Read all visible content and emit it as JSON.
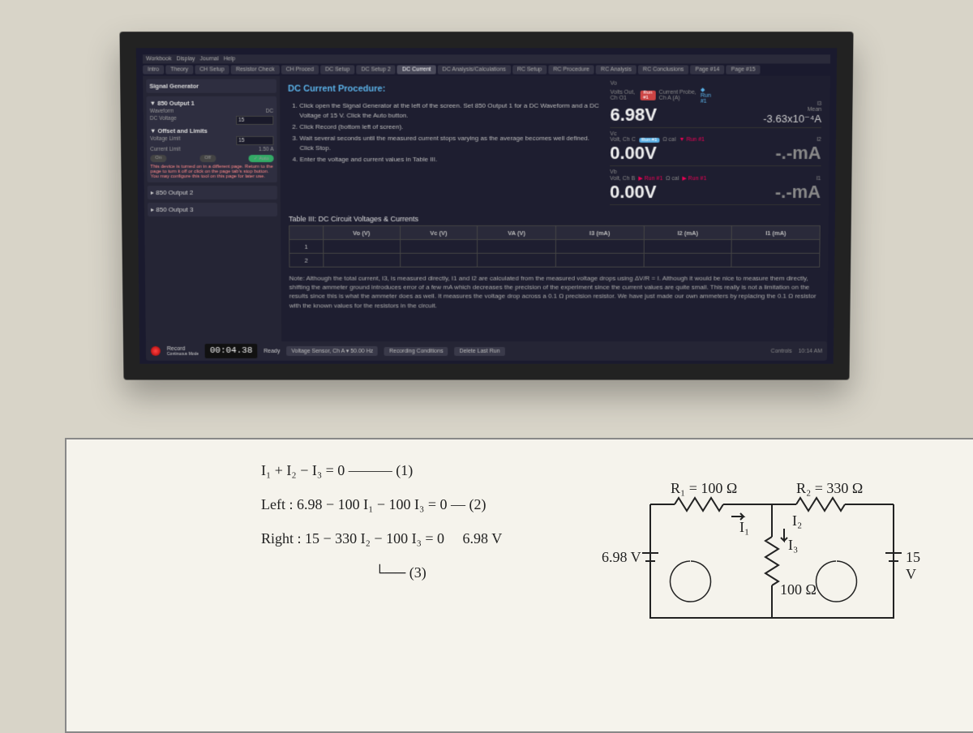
{
  "menubar": [
    "Workbook",
    "Display",
    "Journal",
    "Help"
  ],
  "tabs": [
    "Intro",
    "Theory",
    "CH Setup",
    "Resistor Check",
    "CH Proced",
    "DC Setup",
    "DC Setup 2",
    "DC Current",
    "DC Analysis/Calculations",
    "RC Setup",
    "RC Procedure",
    "RC Analysis",
    "RC Conclusions",
    "Page #14",
    "Page #15"
  ],
  "active_tab": 7,
  "sidebar": {
    "panel1_title": "Signal Generator",
    "output1_title": "850 Output 1",
    "waveform_label": "Waveform",
    "waveform_value": "DC",
    "dcvoltage_label": "DC Voltage",
    "dcvoltage_value": "15",
    "offset_title": "Offset and Limits",
    "vlimit_label": "Voltage Limit",
    "vlimit_value": "15",
    "climit_label": "Current Limit",
    "climit_value": "1.50 A",
    "on": "On",
    "off": "Off",
    "auto": "Auto",
    "warning": "This device is turned on in a different page. Return to the page to turn it off or click on the page tab's stop button. You may configure this tool on this page for later use.",
    "output2": "850 Output 2",
    "output3": "850 Output 3"
  },
  "procedure": {
    "title": "DC Current Procedure:",
    "steps": [
      "Click open the Signal Generator at the left of the screen. Set 850 Output 1 for a DC Waveform and a DC Voltage of 15 V. Click the Auto button.",
      "Click Record (bottom left of screen).",
      "Wait several seconds until the measured current stops varying as the average becomes well defined. Click Stop.",
      "Enter the voltage and current values in Table III."
    ]
  },
  "measurements": {
    "vo": {
      "label": "Vo",
      "sub": "Volts Out, Ch O1",
      "run": "Run #1",
      "probe": "Current Probe, Ch A (A)",
      "value": "6.98V",
      "i_label": "I3",
      "i_sub": "Mean",
      "i_value": "-3.63x10⁻⁴A",
      "extra": "Run #1"
    },
    "vc": {
      "label": "Vc",
      "sub": "Volt, Ch C",
      "run": "Run #1",
      "probe": "Ω cal",
      "value": "0.00V",
      "i_label": "I2",
      "i_value": "-.-mA",
      "extra": "Run #1"
    },
    "vb": {
      "label": "Vb",
      "sub": "Volt, Ch B",
      "run": "Run #1",
      "probe": "Ω cal",
      "value": "0.00V",
      "i_label": "I1",
      "i_value": "-.-mA",
      "extra": "Run #1"
    }
  },
  "table": {
    "title": "Table III: DC Circuit Voltages & Currents",
    "headers": [
      "",
      "Vo (V)",
      "Vc (V)",
      "VA (V)",
      "I3 (mA)",
      "I2 (mA)",
      "I1 (mA)"
    ],
    "rows": [
      "1",
      "2"
    ]
  },
  "note": "Note: Although the total current, I3, is measured directly, I1 and I2 are calculated from the measured voltage drops using ΔV/R = I. Although it would be nice to measure them directly, shifting the ammeter ground introduces error of a few mA which decreases the precision of the experiment since the current values are quite small. This really is not a limitation on the results since this is what the ammeter does as well. It measures the voltage drop across a 0.1 Ω precision resistor. We have just made our own ammeters by replacing the 0.1 Ω resistor with the known values for the resistors in the circuit.",
  "bottombar": {
    "record": "Record",
    "mode": "Continuous Mode",
    "time": "00:04.38",
    "ready": "Ready",
    "sensor": "Voltage Sensor, Ch A",
    "rate": "50.00 Hz",
    "recording_cond": "Recording Conditions",
    "delete": "Delete Last Run",
    "controls": "Controls",
    "clock": "10:14 AM"
  },
  "whiteboard": {
    "eq1": "I₁ + I₂ − I₃ = 0 ——— (1)",
    "eq2": "Left :   6.98 − 100 I₁ − 100 I₃ = 0 — (2)",
    "eq3": "Right :  15 − 330 I₂ − 100 I₃ = 0",
    "eq3_tag": "(3)",
    "vsrc1": "6.98 V",
    "vsrc2": "15 V",
    "r1": "R₁ = 100 Ω",
    "r2": "R₂ = 330 Ω",
    "r3": "100 Ω",
    "i1": "I₁",
    "i2": "I₂",
    "i3": "I₃"
  }
}
